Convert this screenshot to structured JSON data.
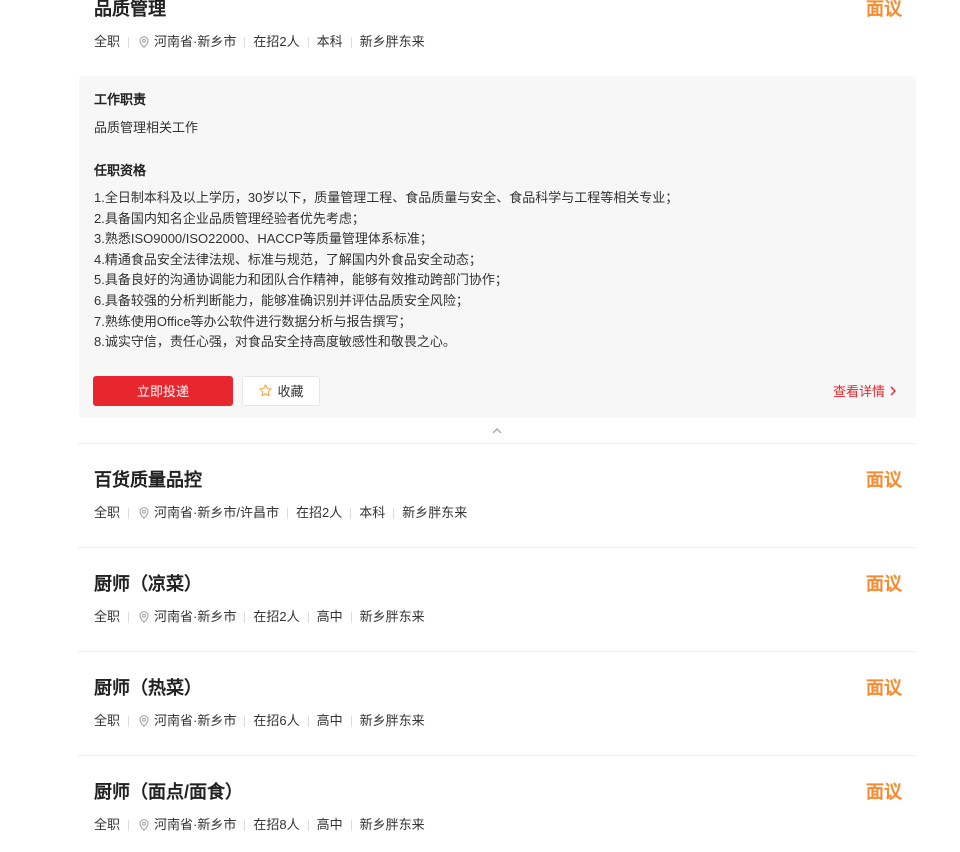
{
  "colors": {
    "salary": "#fa8a2e",
    "primary": "#e7262d",
    "panel_bg": "#f7f7f7",
    "divider": "#eeeeee",
    "star": "#f4a13a"
  },
  "icons": {
    "location": "location-pin-icon",
    "favorite": "star-outline-icon",
    "details_arrow": "chevron-right-icon",
    "collapse": "chevron-up-icon"
  },
  "jobs": [
    {
      "title": "品质管理",
      "salary": "面议",
      "meta": {
        "type": "全职",
        "location": "河南省·新乡市",
        "openings": "在招2人",
        "education": "本科",
        "company": "新乡胖东来"
      },
      "detail": {
        "duties_heading": "工作职责",
        "duties": "品质管理相关工作",
        "requirements_heading": "任职资格",
        "requirements": [
          "1.全日制本科及以上学历，30岁以下，质量管理工程、食品质量与安全、食品科学与工程等相关专业；",
          "2.具备国内知名企业品质管理经验者优先考虑；",
          "3.熟悉ISO9000/ISO22000、HACCP等质量管理体系标准；",
          "4.精通食品安全法律法规、标准与规范，了解国内外食品安全动态；",
          "5.具备良好的沟通协调能力和团队合作精神，能够有效推动跨部门协作；",
          "6.具备较强的分析判断能力，能够准确识别并评估品质安全风险；",
          "7.熟练使用Office等办公软件进行数据分析与报告撰写；",
          "8.诚实守信，责任心强，对食品安全持高度敏感性和敬畏之心。"
        ],
        "apply_label": "立即投递",
        "favorite_label": "收藏",
        "view_details_label": "查看详情"
      }
    },
    {
      "title": "百货质量品控",
      "salary": "面议",
      "meta": {
        "type": "全职",
        "location": "河南省·新乡市/许昌市",
        "openings": "在招2人",
        "education": "本科",
        "company": "新乡胖东来"
      }
    },
    {
      "title": "厨师（凉菜）",
      "salary": "面议",
      "meta": {
        "type": "全职",
        "location": "河南省·新乡市",
        "openings": "在招2人",
        "education": "高中",
        "company": "新乡胖东来"
      }
    },
    {
      "title": "厨师（热菜）",
      "salary": "面议",
      "meta": {
        "type": "全职",
        "location": "河南省·新乡市",
        "openings": "在招6人",
        "education": "高中",
        "company": "新乡胖东来"
      }
    },
    {
      "title": "厨师（面点/面食）",
      "salary": "面议",
      "meta": {
        "type": "全职",
        "location": "河南省·新乡市",
        "openings": "在招8人",
        "education": "高中",
        "company": "新乡胖东来"
      }
    }
  ]
}
